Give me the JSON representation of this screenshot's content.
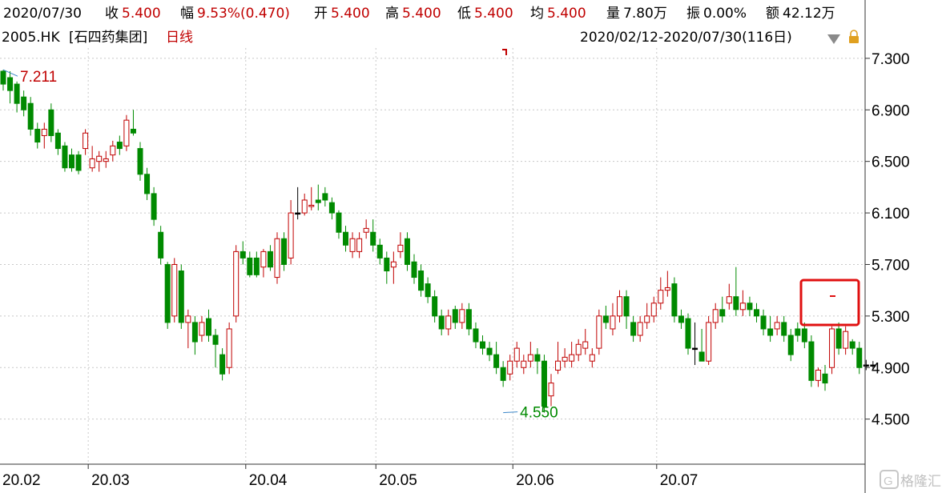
{
  "info": {
    "date": "2020/07/30",
    "close_label": "收",
    "close_value": "5.400",
    "change_label": "幅",
    "change_value": "9.53%(0.470)",
    "open_label": "开",
    "open_value": "5.400",
    "high_label": "高",
    "high_value": "5.400",
    "low_label": "低",
    "low_value": "5.400",
    "avg_label": "均",
    "avg_value": "5.400",
    "volume_label": "量",
    "volume_value": "7.80万",
    "amplitude_label": "振",
    "amplitude_value": "0.00%",
    "amount_label": "额",
    "amount_value": "42.12万"
  },
  "header": {
    "code": "2005.HK",
    "name": "[石四药集团]",
    "period": "日线",
    "range": "2020/02/12-2020/07/30(116日)"
  },
  "colors": {
    "up": "#c00000",
    "down": "#008a00",
    "grid": "#c8c8c8",
    "highlight_box": "#e01010",
    "axis": "#333333"
  },
  "icons": [
    "dropdown-arrow-icon",
    "lock-icon"
  ],
  "watermark": "格隆汇",
  "chart_data": {
    "type": "candlestick",
    "title": "2005.HK [石四药集团] 日线",
    "ylim": [
      4.15,
      7.38
    ],
    "y_ticks": [
      "7.300",
      "6.900",
      "6.500",
      "6.100",
      "5.700",
      "5.300",
      "4.900",
      "4.500"
    ],
    "x_ticks": [
      "20.02",
      "20.03",
      "20.04",
      "20.05",
      "20.06",
      "20.07"
    ],
    "x_tick_index": [
      0,
      13,
      36,
      55,
      75,
      96
    ],
    "annotations": [
      {
        "label": "7.211",
        "index": 0,
        "price": 7.211,
        "kind": "high"
      },
      {
        "label": "4.550",
        "index": 73,
        "price": 4.55,
        "kind": "low"
      }
    ],
    "candles": [
      [
        7.2,
        7.1,
        7.21,
        7.05
      ],
      [
        7.15,
        7.05,
        7.2,
        6.95
      ],
      [
        7.1,
        6.95,
        7.12,
        6.88
      ],
      [
        7.0,
        6.9,
        7.05,
        6.85
      ],
      [
        6.95,
        6.75,
        7.0,
        6.7
      ],
      [
        6.75,
        6.65,
        6.8,
        6.6
      ],
      [
        6.7,
        6.75,
        6.8,
        6.6
      ],
      [
        6.9,
        6.7,
        6.95,
        6.65
      ],
      [
        6.72,
        6.6,
        6.75,
        6.55
      ],
      [
        6.62,
        6.45,
        6.65,
        6.42
      ],
      [
        6.55,
        6.45,
        6.6,
        6.42
      ],
      [
        6.55,
        6.43,
        6.58,
        6.4
      ],
      [
        6.6,
        6.72,
        6.75,
        6.55
      ],
      [
        6.45,
        6.52,
        6.62,
        6.42
      ],
      [
        6.5,
        6.54,
        6.58,
        6.42
      ],
      [
        6.5,
        6.52,
        6.58,
        6.45
      ],
      [
        6.55,
        6.62,
        6.66,
        6.5
      ],
      [
        6.65,
        6.6,
        6.7,
        6.55
      ],
      [
        6.62,
        6.82,
        6.86,
        6.58
      ],
      [
        6.75,
        6.72,
        6.9,
        6.7
      ],
      [
        6.6,
        6.4,
        6.65,
        6.35
      ],
      [
        6.4,
        6.25,
        6.45,
        6.2
      ],
      [
        6.25,
        6.05,
        6.3,
        6.0
      ],
      [
        5.95,
        5.75,
        6.0,
        5.7
      ],
      [
        5.7,
        5.25,
        5.72,
        5.2
      ],
      [
        5.3,
        5.7,
        5.75,
        5.25
      ],
      [
        5.65,
        5.25,
        5.7,
        5.2
      ],
      [
        5.25,
        5.3,
        5.35,
        5.05
      ],
      [
        5.25,
        5.1,
        5.3,
        5.0
      ],
      [
        5.15,
        5.25,
        5.3,
        5.1
      ],
      [
        5.28,
        5.15,
        5.35,
        5.1
      ],
      [
        5.15,
        5.08,
        5.2,
        4.9
      ],
      [
        5.0,
        4.85,
        5.05,
        4.8
      ],
      [
        4.9,
        5.2,
        5.25,
        4.85
      ],
      [
        5.3,
        5.8,
        5.85,
        5.25
      ],
      [
        5.8,
        5.75,
        5.88,
        5.7
      ],
      [
        5.75,
        5.62,
        5.8,
        5.6
      ],
      [
        5.75,
        5.62,
        5.8,
        5.6
      ],
      [
        5.68,
        5.8,
        5.82,
        5.6
      ],
      [
        5.8,
        5.68,
        5.85,
        5.65
      ],
      [
        5.6,
        5.9,
        5.95,
        5.55
      ],
      [
        5.9,
        5.7,
        5.95,
        5.65
      ],
      [
        5.75,
        6.1,
        6.2,
        5.7
      ],
      [
        6.1,
        6.1,
        6.3,
        6.05
      ],
      [
        6.1,
        6.2,
        6.25,
        6.08
      ],
      [
        6.15,
        6.16,
        6.3,
        6.12
      ],
      [
        6.2,
        6.18,
        6.32,
        6.12
      ],
      [
        6.25,
        6.2,
        6.3,
        6.15
      ],
      [
        6.18,
        6.1,
        6.22,
        6.05
      ],
      [
        6.1,
        5.95,
        6.12,
        5.9
      ],
      [
        5.95,
        5.85,
        6.0,
        5.8
      ],
      [
        5.8,
        5.9,
        5.95,
        5.75
      ],
      [
        5.8,
        5.9,
        5.95,
        5.75
      ],
      [
        5.95,
        5.98,
        6.05,
        5.9
      ],
      [
        5.95,
        5.85,
        6.05,
        5.8
      ],
      [
        5.85,
        5.75,
        5.9,
        5.7
      ],
      [
        5.75,
        5.65,
        5.8,
        5.55
      ],
      [
        5.68,
        5.72,
        5.8,
        5.55
      ],
      [
        5.8,
        5.85,
        5.95,
        5.75
      ],
      [
        5.9,
        5.7,
        5.95,
        5.65
      ],
      [
        5.72,
        5.6,
        5.78,
        5.55
      ],
      [
        5.65,
        5.5,
        5.7,
        5.45
      ],
      [
        5.55,
        5.45,
        5.6,
        5.4
      ],
      [
        5.45,
        5.3,
        5.5,
        5.25
      ],
      [
        5.3,
        5.2,
        5.35,
        5.15
      ],
      [
        5.2,
        5.3,
        5.35,
        5.15
      ],
      [
        5.35,
        5.25,
        5.38,
        5.2
      ],
      [
        5.25,
        5.35,
        5.4,
        5.2
      ],
      [
        5.35,
        5.2,
        5.4,
        5.15
      ],
      [
        5.2,
        5.1,
        5.25,
        5.05
      ],
      [
        5.1,
        5.05,
        5.15,
        5.0
      ],
      [
        5.05,
        5.0,
        5.1,
        4.95
      ],
      [
        5.0,
        4.9,
        5.1,
        4.85
      ],
      [
        4.9,
        4.8,
        4.95,
        4.75
      ],
      [
        4.85,
        4.95,
        5.0,
        4.8
      ],
      [
        4.95,
        5.05,
        5.1,
        4.9
      ],
      [
        4.9,
        4.95,
        5.0,
        4.85
      ],
      [
        4.95,
        5.0,
        5.1,
        4.9
      ],
      [
        5.0,
        4.95,
        5.05,
        4.85
      ],
      [
        4.95,
        4.6,
        5.0,
        4.55
      ],
      [
        4.68,
        4.78,
        4.85,
        4.6
      ],
      [
        4.88,
        4.95,
        5.1,
        4.85
      ],
      [
        4.95,
        4.98,
        5.05,
        4.9
      ],
      [
        4.95,
        5.0,
        5.1,
        4.9
      ],
      [
        5.0,
        5.08,
        5.12,
        4.95
      ],
      [
        5.05,
        5.1,
        5.2,
        5.0
      ],
      [
        4.95,
        5.0,
        5.05,
        4.9
      ],
      [
        5.05,
        5.3,
        5.35,
        5.0
      ],
      [
        5.3,
        5.25,
        5.38,
        5.2
      ],
      [
        5.2,
        5.3,
        5.4,
        5.15
      ],
      [
        5.3,
        5.45,
        5.5,
        5.25
      ],
      [
        5.45,
        5.3,
        5.5,
        5.2
      ],
      [
        5.25,
        5.15,
        5.3,
        5.1
      ],
      [
        5.15,
        5.25,
        5.3,
        5.1
      ],
      [
        5.25,
        5.3,
        5.4,
        5.2
      ],
      [
        5.3,
        5.4,
        5.45,
        5.25
      ],
      [
        5.4,
        5.5,
        5.6,
        5.35
      ],
      [
        5.5,
        5.52,
        5.65,
        5.45
      ],
      [
        5.55,
        5.3,
        5.6,
        5.25
      ],
      [
        5.3,
        5.25,
        5.35,
        5.2
      ],
      [
        5.28,
        5.05,
        5.32,
        5.0
      ],
      [
        5.05,
        5.05,
        5.25,
        4.92
      ],
      [
        5.02,
        4.95,
        5.2,
        4.95
      ],
      [
        4.95,
        5.25,
        5.3,
        4.92
      ],
      [
        5.25,
        5.35,
        5.4,
        5.2
      ],
      [
        5.35,
        5.3,
        5.45,
        5.25
      ],
      [
        5.4,
        5.45,
        5.55,
        5.35
      ],
      [
        5.45,
        5.35,
        5.68,
        5.3
      ],
      [
        5.35,
        5.4,
        5.5,
        5.3
      ],
      [
        5.4,
        5.35,
        5.45,
        5.3
      ],
      [
        5.35,
        5.3,
        5.4,
        5.25
      ],
      [
        5.3,
        5.2,
        5.35,
        5.15
      ],
      [
        5.2,
        5.15,
        5.3,
        5.1
      ],
      [
        5.2,
        5.25,
        5.3,
        5.15
      ],
      [
        5.25,
        5.15,
        5.3,
        5.1
      ],
      [
        5.15,
        5.0,
        5.2,
        4.95
      ],
      [
        5.2,
        5.15,
        5.25,
        5.1
      ],
      [
        5.2,
        5.1,
        5.25,
        5.05
      ],
      [
        5.1,
        4.8,
        5.15,
        4.75
      ],
      [
        4.8,
        4.88,
        4.9,
        4.75
      ],
      [
        4.85,
        4.78,
        4.92,
        4.72
      ],
      [
        4.9,
        5.2,
        5.22,
        4.85
      ],
      [
        5.2,
        5.05,
        5.25,
        5.0
      ],
      [
        5.05,
        5.18,
        5.22,
        5.0
      ],
      [
        5.1,
        5.05,
        5.12,
        5.0
      ],
      [
        5.05,
        4.9,
        5.1,
        4.85
      ],
      [
        4.92,
        4.92,
        4.96,
        4.88
      ],
      [
        4.92,
        4.92,
        4.95,
        4.88
      ]
    ]
  }
}
